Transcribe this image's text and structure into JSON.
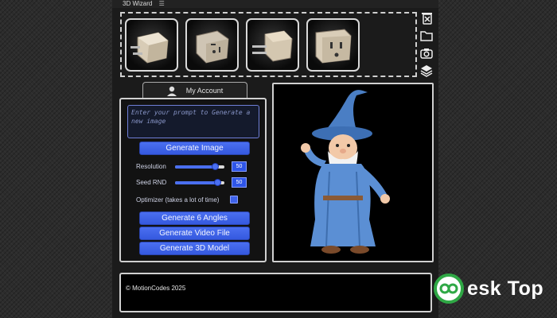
{
  "window": {
    "title": "3D Wizard",
    "menu_icon": "hamburger-icon"
  },
  "thumbnails": [
    {
      "label": "plug-view-1"
    },
    {
      "label": "plug-view-2"
    },
    {
      "label": "plug-view-3"
    },
    {
      "label": "plug-view-4"
    }
  ],
  "tools": [
    "close-file-icon",
    "folder-icon",
    "camera-icon",
    "layers-icon"
  ],
  "tab": {
    "label": "My Account",
    "icon": "user-icon"
  },
  "prompt": {
    "placeholder": "Enter your prompt to Generate a new image",
    "value": ""
  },
  "buttons": {
    "generate_image": "Generate Image",
    "generate_angles": "Generate 6 Angles",
    "generate_video": "Generate Video File",
    "generate_model": "Generate 3D Model"
  },
  "resolution": {
    "label": "Resolution",
    "value": "50",
    "level": 0.8
  },
  "seed": {
    "label": "Seed RND",
    "value": "50",
    "level": 0.85
  },
  "optimizer": {
    "label": "Optimizer (takes a lot of time)",
    "checked": true
  },
  "footer": {
    "text": "© MotionCodes 2025"
  },
  "watermark": {
    "text": "esk Top"
  },
  "colors": {
    "accent": "#3f63ea",
    "panel_border": "#d0d0d0",
    "background": "#1b1b1b"
  }
}
